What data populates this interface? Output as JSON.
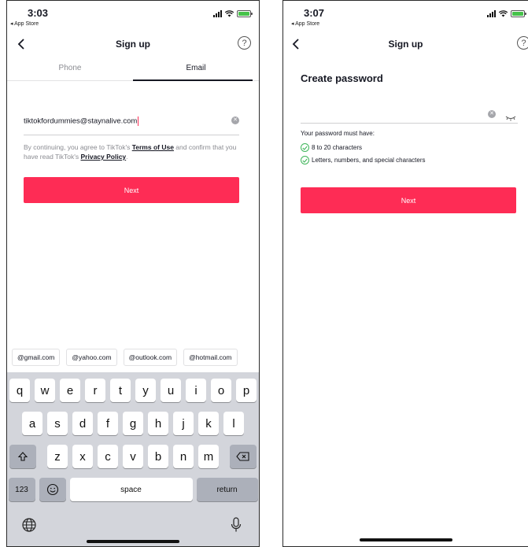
{
  "screen_a": {
    "status": {
      "time": "3:03",
      "back_label": "◂ App Store"
    },
    "nav": {
      "title": "Sign up",
      "help": "?"
    },
    "tabs": [
      {
        "label": "Phone"
      },
      {
        "label": "Email"
      }
    ],
    "email": {
      "value": "tiktokfordummies@staynalive.com"
    },
    "terms": {
      "prefix": "By continuing, you agree to TikTok's ",
      "terms_link": "Terms of Use",
      "middle": " and confirm that you have read TikTok's ",
      "privacy_link": "Privacy Policy",
      "suffix": "."
    },
    "next_label": "Next",
    "suggestions": [
      "@gmail.com",
      "@yahoo.com",
      "@outlook.com",
      "@hotmail.com"
    ],
    "keyboard": {
      "row1": [
        "q",
        "w",
        "e",
        "r",
        "t",
        "y",
        "u",
        "i",
        "o",
        "p"
      ],
      "row2": [
        "a",
        "s",
        "d",
        "f",
        "g",
        "h",
        "j",
        "k",
        "l"
      ],
      "row3": [
        "z",
        "x",
        "c",
        "v",
        "b",
        "n",
        "m"
      ],
      "numbers": "123",
      "space": "space",
      "return": "return"
    }
  },
  "screen_b": {
    "status": {
      "time": "3:07",
      "back_label": "◂ App Store"
    },
    "nav": {
      "title": "Sign up",
      "help": "?"
    },
    "title": "Create password",
    "requirements_heading": "Your password must have:",
    "requirements": [
      "8 to 20 characters",
      "Letters, numbers, and special characters"
    ],
    "next_label": "Next"
  },
  "colors": {
    "accent": "#fe2c55",
    "check": "#3fb55a",
    "keyboard_bg": "#d3d5db"
  }
}
